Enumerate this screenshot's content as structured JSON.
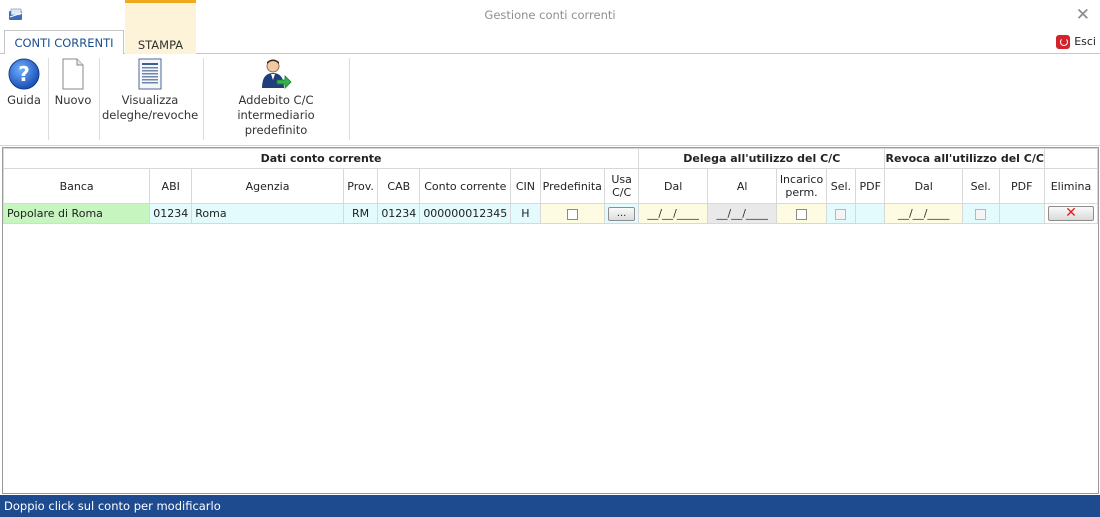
{
  "window": {
    "title": "Gestione conti correnti"
  },
  "tabs": {
    "conti": "CONTI CORRENTI",
    "stampa": "STAMPA"
  },
  "esci_label": "Esci",
  "ribbon": {
    "guida": "Guida",
    "nuovo": "Nuovo",
    "visualizza_l1": "Visualizza",
    "visualizza_l2": "deleghe/revoche",
    "addebito_l1": "Addebito C/C",
    "addebito_l2": "intermediario predefinito"
  },
  "grid": {
    "groups": {
      "dati": "Dati conto corrente",
      "delega": "Delega all'utilizzo del C/C",
      "revoca": "Revoca all'utilizzo del C/C"
    },
    "columns": {
      "banca": "Banca",
      "abi": "ABI",
      "agenzia": "Agenzia",
      "prov": "Prov.",
      "cab": "CAB",
      "conto": "Conto corrente",
      "cin": "CIN",
      "predefinita": "Predefinita",
      "usa": "Usa C/C",
      "dal": "Dal",
      "al": "Al",
      "incarico": "Incarico perm.",
      "sel": "Sel.",
      "pdf": "PDF",
      "rev_dal": "Dal",
      "rev_sel": "Sel.",
      "rev_pdf": "PDF",
      "elimina": "Elimina"
    },
    "row": {
      "banca": "Popolare di Roma",
      "abi": "01234",
      "agenzia": "Roma",
      "prov": "RM",
      "cab": "01234",
      "conto": "000000012345",
      "cin": "H",
      "usa_btn": "...",
      "dal": "__/__/____",
      "al": "__/__/____",
      "rev_dal": "__/__/____",
      "elimina_icon": "✕"
    }
  },
  "status": "Doppio click sul conto per modificarlo",
  "colors": {
    "status_bar": "#1e4b8f",
    "tab_accent": "#f0a81c",
    "row_green": "#c6f5c0",
    "row_cyan": "#e4fbfd"
  },
  "icons": [
    "app-icon",
    "close-icon",
    "esci-icon",
    "help-icon",
    "new-document-icon",
    "report-icon",
    "user-transfer-icon",
    "delete-x-icon"
  ]
}
